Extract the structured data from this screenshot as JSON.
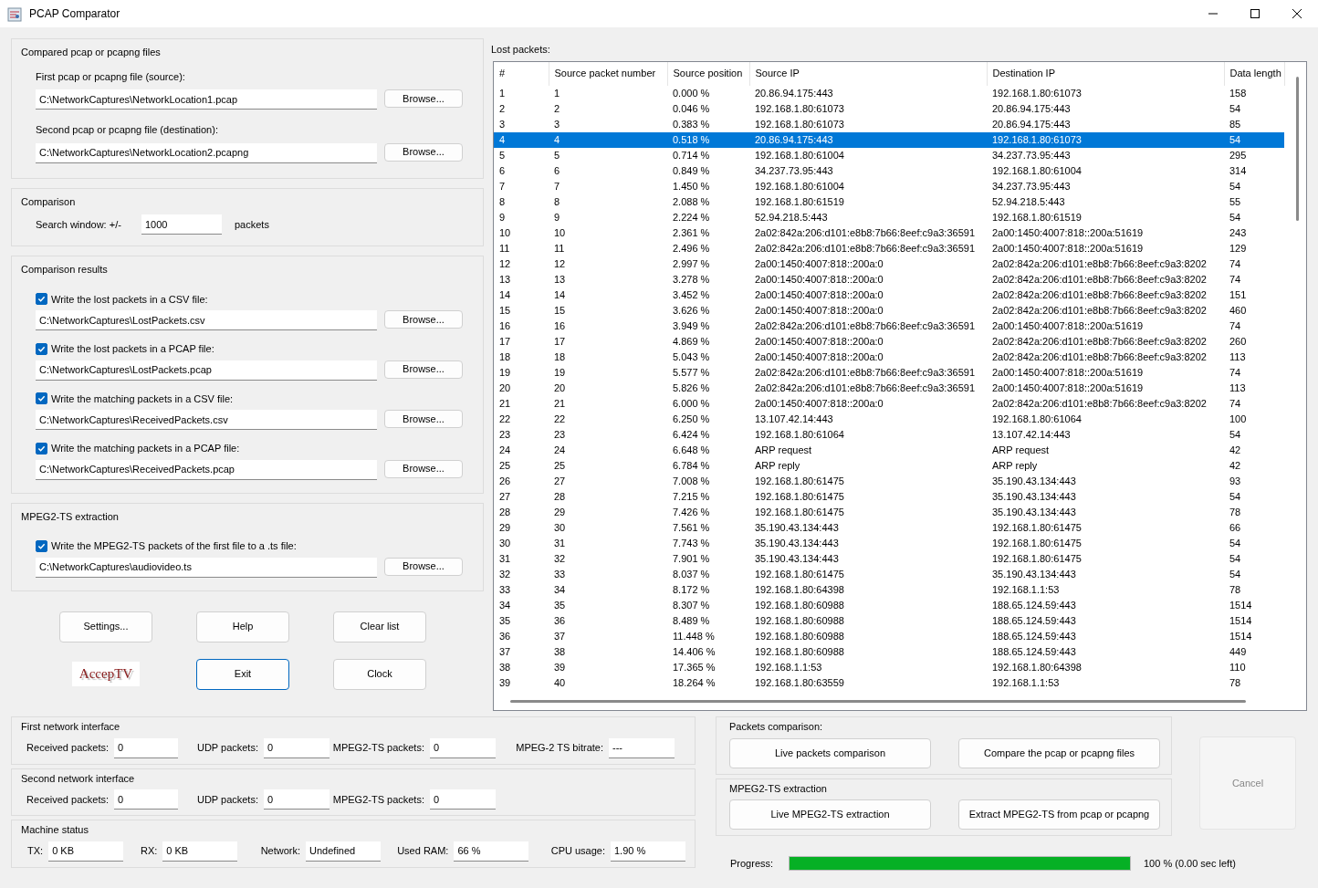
{
  "window": {
    "title": "PCAP Comparator"
  },
  "compared_files": {
    "title": "Compared pcap or pcapng files",
    "fields": [
      {
        "label": "First pcap or pcapng file (source):",
        "value": "C:\\NetworkCaptures\\NetworkLocation1.pcap",
        "button": "Browse..."
      },
      {
        "label": "Second pcap or pcapng file (destination):",
        "value": "C:\\NetworkCaptures\\NetworkLocation2.pcapng",
        "button": "Browse..."
      }
    ]
  },
  "comparison": {
    "title": "Comparison",
    "label": "Search window: +/-",
    "value": "1000",
    "unit": "packets"
  },
  "comparison_results": {
    "title": "Comparison results",
    "items": [
      {
        "label": "Write the lost packets in a CSV file:",
        "checked": true,
        "value": "C:\\NetworkCaptures\\LostPackets.csv",
        "button": "Browse..."
      },
      {
        "label": "Write the lost packets in a PCAP file:",
        "checked": true,
        "value": "C:\\NetworkCaptures\\LostPackets.pcap",
        "button": "Browse..."
      },
      {
        "label": "Write the matching packets in a CSV file:",
        "checked": true,
        "value": "C:\\NetworkCaptures\\ReceivedPackets.csv",
        "button": "Browse..."
      },
      {
        "label": "Write the matching packets in a PCAP file:",
        "checked": true,
        "value": "C:\\NetworkCaptures\\ReceivedPackets.pcap",
        "button": "Browse..."
      }
    ]
  },
  "mpeg2ts_extraction": {
    "title": "MPEG2-TS extraction",
    "items": [
      {
        "label": "Write the MPEG2-TS packets of the first file to a .ts file:",
        "checked": true,
        "value": "C:\\NetworkCaptures\\audiovideo.ts",
        "button": "Browse..."
      }
    ]
  },
  "buttons": [
    {
      "label": "Settings...",
      "focused": false
    },
    {
      "label": "Help",
      "focused": false
    },
    {
      "label": "Clear list",
      "focused": false
    },
    {
      "label": "Exit",
      "focused": true
    },
    {
      "label": "Clock",
      "focused": false
    }
  ],
  "logo": {
    "text": "AccepTV"
  },
  "lost_packets": {
    "title": "Lost packets:",
    "columns": [
      "#",
      "Source packet number",
      "Source position",
      "Source IP",
      "Destination IP",
      "Data length"
    ],
    "rows": [
      {
        "cells": [
          "1",
          "1",
          "0.000 %",
          "20.86.94.175:443",
          "192.168.1.80:61073",
          "158"
        ],
        "selected": false
      },
      {
        "cells": [
          "2",
          "2",
          "0.046 %",
          "192.168.1.80:61073",
          "20.86.94.175:443",
          "54"
        ],
        "selected": false
      },
      {
        "cells": [
          "3",
          "3",
          "0.383 %",
          "192.168.1.80:61073",
          "20.86.94.175:443",
          "85"
        ],
        "selected": false
      },
      {
        "cells": [
          "4",
          "4",
          "0.518 %",
          "20.86.94.175:443",
          "192.168.1.80:61073",
          "54"
        ],
        "selected": true
      },
      {
        "cells": [
          "5",
          "5",
          "0.714 %",
          "192.168.1.80:61004",
          "34.237.73.95:443",
          "295"
        ],
        "selected": false
      },
      {
        "cells": [
          "6",
          "6",
          "0.849 %",
          "34.237.73.95:443",
          "192.168.1.80:61004",
          "314"
        ],
        "selected": false
      },
      {
        "cells": [
          "7",
          "7",
          "1.450 %",
          "192.168.1.80:61004",
          "34.237.73.95:443",
          "54"
        ],
        "selected": false
      },
      {
        "cells": [
          "8",
          "8",
          "2.088 %",
          "192.168.1.80:61519",
          "52.94.218.5:443",
          "55"
        ],
        "selected": false
      },
      {
        "cells": [
          "9",
          "9",
          "2.224 %",
          "52.94.218.5:443",
          "192.168.1.80:61519",
          "54"
        ],
        "selected": false
      },
      {
        "cells": [
          "10",
          "10",
          "2.361 %",
          "2a02:842a:206:d101:e8b8:7b66:8eef:c9a3:36591",
          "2a00:1450:4007:818::200a:51619",
          "243"
        ],
        "selected": false
      },
      {
        "cells": [
          "11",
          "11",
          "2.496 %",
          "2a02:842a:206:d101:e8b8:7b66:8eef:c9a3:36591",
          "2a00:1450:4007:818::200a:51619",
          "129"
        ],
        "selected": false
      },
      {
        "cells": [
          "12",
          "12",
          "2.997 %",
          "2a00:1450:4007:818::200a:0",
          "2a02:842a:206:d101:e8b8:7b66:8eef:c9a3:8202",
          "74"
        ],
        "selected": false
      },
      {
        "cells": [
          "13",
          "13",
          "3.278 %",
          "2a00:1450:4007:818::200a:0",
          "2a02:842a:206:d101:e8b8:7b66:8eef:c9a3:8202",
          "74"
        ],
        "selected": false
      },
      {
        "cells": [
          "14",
          "14",
          "3.452 %",
          "2a00:1450:4007:818::200a:0",
          "2a02:842a:206:d101:e8b8:7b66:8eef:c9a3:8202",
          "151"
        ],
        "selected": false
      },
      {
        "cells": [
          "15",
          "15",
          "3.626 %",
          "2a00:1450:4007:818::200a:0",
          "2a02:842a:206:d101:e8b8:7b66:8eef:c9a3:8202",
          "460"
        ],
        "selected": false
      },
      {
        "cells": [
          "16",
          "16",
          "3.949 %",
          "2a02:842a:206:d101:e8b8:7b66:8eef:c9a3:36591",
          "2a00:1450:4007:818::200a:51619",
          "74"
        ],
        "selected": false
      },
      {
        "cells": [
          "17",
          "17",
          "4.869 %",
          "2a00:1450:4007:818::200a:0",
          "2a02:842a:206:d101:e8b8:7b66:8eef:c9a3:8202",
          "260"
        ],
        "selected": false
      },
      {
        "cells": [
          "18",
          "18",
          "5.043 %",
          "2a00:1450:4007:818::200a:0",
          "2a02:842a:206:d101:e8b8:7b66:8eef:c9a3:8202",
          "113"
        ],
        "selected": false
      },
      {
        "cells": [
          "19",
          "19",
          "5.577 %",
          "2a02:842a:206:d101:e8b8:7b66:8eef:c9a3:36591",
          "2a00:1450:4007:818::200a:51619",
          "74"
        ],
        "selected": false
      },
      {
        "cells": [
          "20",
          "20",
          "5.826 %",
          "2a02:842a:206:d101:e8b8:7b66:8eef:c9a3:36591",
          "2a00:1450:4007:818::200a:51619",
          "113"
        ],
        "selected": false
      },
      {
        "cells": [
          "21",
          "21",
          "6.000 %",
          "2a00:1450:4007:818::200a:0",
          "2a02:842a:206:d101:e8b8:7b66:8eef:c9a3:8202",
          "74"
        ],
        "selected": false
      },
      {
        "cells": [
          "22",
          "22",
          "6.250 %",
          "13.107.42.14:443",
          "192.168.1.80:61064",
          "100"
        ],
        "selected": false
      },
      {
        "cells": [
          "23",
          "23",
          "6.424 %",
          "192.168.1.80:61064",
          "13.107.42.14:443",
          "54"
        ],
        "selected": false
      },
      {
        "cells": [
          "24",
          "24",
          "6.648 %",
          "ARP request",
          "ARP request",
          "42"
        ],
        "selected": false
      },
      {
        "cells": [
          "25",
          "25",
          "6.784 %",
          "ARP reply",
          "ARP reply",
          "42"
        ],
        "selected": false
      },
      {
        "cells": [
          "26",
          "27",
          "7.008 %",
          "192.168.1.80:61475",
          "35.190.43.134:443",
          "93"
        ],
        "selected": false
      },
      {
        "cells": [
          "27",
          "28",
          "7.215 %",
          "192.168.1.80:61475",
          "35.190.43.134:443",
          "54"
        ],
        "selected": false
      },
      {
        "cells": [
          "28",
          "29",
          "7.426 %",
          "192.168.1.80:61475",
          "35.190.43.134:443",
          "78"
        ],
        "selected": false
      },
      {
        "cells": [
          "29",
          "30",
          "7.561 %",
          "35.190.43.134:443",
          "192.168.1.80:61475",
          "66"
        ],
        "selected": false
      },
      {
        "cells": [
          "30",
          "31",
          "7.743 %",
          "35.190.43.134:443",
          "192.168.1.80:61475",
          "54"
        ],
        "selected": false
      },
      {
        "cells": [
          "31",
          "32",
          "7.901 %",
          "35.190.43.134:443",
          "192.168.1.80:61475",
          "54"
        ],
        "selected": false
      },
      {
        "cells": [
          "32",
          "33",
          "8.037 %",
          "192.168.1.80:61475",
          "35.190.43.134:443",
          "54"
        ],
        "selected": false
      },
      {
        "cells": [
          "33",
          "34",
          "8.172 %",
          "192.168.1.80:64398",
          "192.168.1.1:53",
          "78"
        ],
        "selected": false
      },
      {
        "cells": [
          "34",
          "35",
          "8.307 %",
          "192.168.1.80:60988",
          "188.65.124.59:443",
          "1514"
        ],
        "selected": false
      },
      {
        "cells": [
          "35",
          "36",
          "8.489 %",
          "192.168.1.80:60988",
          "188.65.124.59:443",
          "1514"
        ],
        "selected": false
      },
      {
        "cells": [
          "36",
          "37",
          "11.448 %",
          "192.168.1.80:60988",
          "188.65.124.59:443",
          "1514"
        ],
        "selected": false
      },
      {
        "cells": [
          "37",
          "38",
          "14.406 %",
          "192.168.1.80:60988",
          "188.65.124.59:443",
          "449"
        ],
        "selected": false
      },
      {
        "cells": [
          "38",
          "39",
          "17.365 %",
          "192.168.1.1:53",
          "192.168.1.80:64398",
          "110"
        ],
        "selected": false
      },
      {
        "cells": [
          "39",
          "40",
          "18.264 %",
          "192.168.1.80:63559",
          "192.168.1.1:53",
          "78"
        ],
        "selected": false
      }
    ]
  },
  "first_network_interface": {
    "title": "First network interface",
    "fields": [
      {
        "label": "Received packets:",
        "value": "0"
      },
      {
        "label": "UDP packets:",
        "value": "0"
      },
      {
        "label": "MPEG2-TS packets:",
        "value": "0"
      },
      {
        "label": "MPEG-2 TS bitrate:",
        "value": "---"
      }
    ]
  },
  "second_network_interface": {
    "title": "Second network interface",
    "fields": [
      {
        "label": "Received packets:",
        "value": "0"
      },
      {
        "label": "UDP packets:",
        "value": "0"
      },
      {
        "label": "MPEG2-TS packets:",
        "value": "0"
      }
    ]
  },
  "machine_status": {
    "title": "Machine status",
    "fields": [
      {
        "label": "TX:",
        "value": "0 KB"
      },
      {
        "label": "RX:",
        "value": "0 KB"
      },
      {
        "label": "Network:",
        "value": "Undefined"
      },
      {
        "label": "Used RAM:",
        "value": "66 %"
      },
      {
        "label": "CPU usage:",
        "value": "1.90 %"
      }
    ]
  },
  "packets_comparison": {
    "title": "Packets comparison:",
    "buttons": [
      "Live packets comparison",
      "Compare the pcap or pcapng files"
    ]
  },
  "mpeg2ts_actions": {
    "title": "MPEG2-TS extraction",
    "buttons": [
      "Live MPEG2-TS extraction",
      "Extract MPEG2-TS from pcap or pcapng"
    ]
  },
  "cancel": {
    "label": "Cancel",
    "disabled": true
  },
  "progress": {
    "label": "Progress:",
    "level": 1,
    "reading": "100 % (0.00 sec left)"
  }
}
